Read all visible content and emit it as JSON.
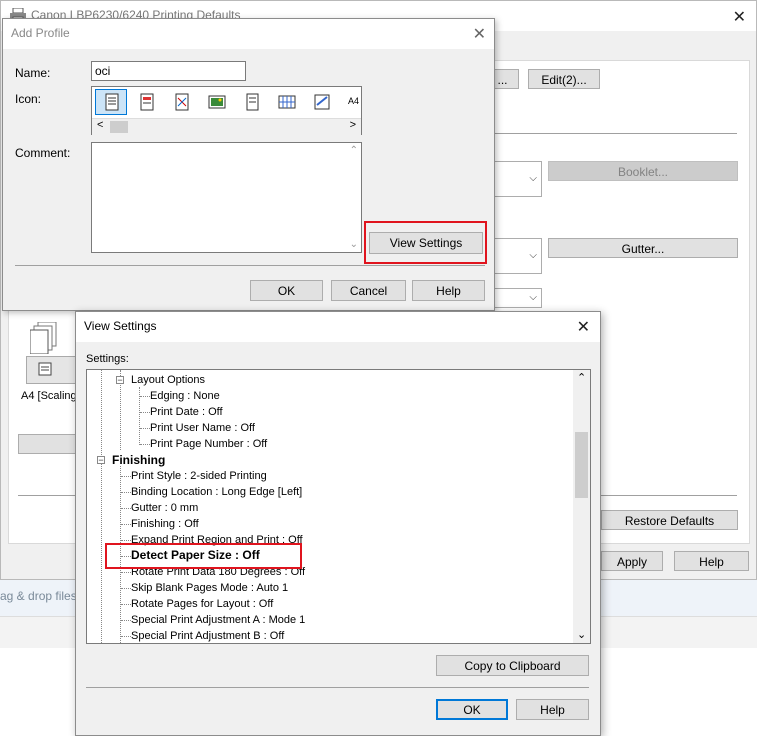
{
  "background_window": {
    "title": "Canon LBP6230/6240 Printing Defaults",
    "edit_button": "Edit(2)...",
    "booklet_button": "Booklet...",
    "gutter_button": "Gutter...",
    "restore_defaults_button": "Restore Defaults",
    "apply_button": "Apply",
    "help_button": "Help",
    "preview_label": "A4 [Scaling",
    "drag_drop_text": "ag & drop files"
  },
  "add_profile": {
    "title": "Add Profile",
    "name_label": "Name:",
    "name_value": "oci",
    "icon_label": "Icon:",
    "comment_label": "Comment:",
    "view_settings_button": "View Settings",
    "ok_button": "OK",
    "cancel_button": "Cancel",
    "help_button": "Help",
    "icons": [
      "document-icon",
      "page-layout-icon",
      "color-page-icon",
      "photo-page-icon",
      "booklet-page-icon",
      "grid-page-icon",
      "poster-page-icon",
      "a4-page-icon"
    ],
    "icon_a4_text": "A4"
  },
  "view_settings": {
    "title": "View Settings",
    "settings_label": "Settings:",
    "tree": [
      {
        "text": "Layout Options",
        "level": 1,
        "bold": false,
        "expander": "minus"
      },
      {
        "text": "Edging : None",
        "level": 2,
        "bold": false
      },
      {
        "text": "Print Date : Off",
        "level": 2,
        "bold": false
      },
      {
        "text": "Print User Name : Off",
        "level": 2,
        "bold": false
      },
      {
        "text": "Print Page Number : Off",
        "level": 2,
        "bold": false
      },
      {
        "text": "Finishing",
        "level": 0,
        "bold": true,
        "expander": "minus"
      },
      {
        "text": "Print Style : 2-sided Printing",
        "level": 1,
        "bold": false
      },
      {
        "text": "Binding Location : Long Edge [Left]",
        "level": 1,
        "bold": false
      },
      {
        "text": "Gutter : 0 mm",
        "level": 1,
        "bold": false
      },
      {
        "text": "Finishing : Off",
        "level": 1,
        "bold": false
      },
      {
        "text": "Expand Print Region and Print : Off",
        "level": 1,
        "bold": false
      },
      {
        "text": "Detect Paper Size : Off",
        "level": 1,
        "bold": true
      },
      {
        "text": "Rotate Print Data 180 Degrees : Off",
        "level": 1,
        "bold": false
      },
      {
        "text": "Skip Blank Pages Mode : Auto 1",
        "level": 1,
        "bold": false
      },
      {
        "text": "Rotate Pages for Layout : Off",
        "level": 1,
        "bold": false
      },
      {
        "text": "Special Print Adjustment A : Mode 1",
        "level": 1,
        "bold": false
      },
      {
        "text": "Special Print Adjustment B : Off",
        "level": 1,
        "bold": false
      }
    ],
    "copy_button": "Copy to Clipboard",
    "ok_button": "OK",
    "help_button": "Help"
  }
}
